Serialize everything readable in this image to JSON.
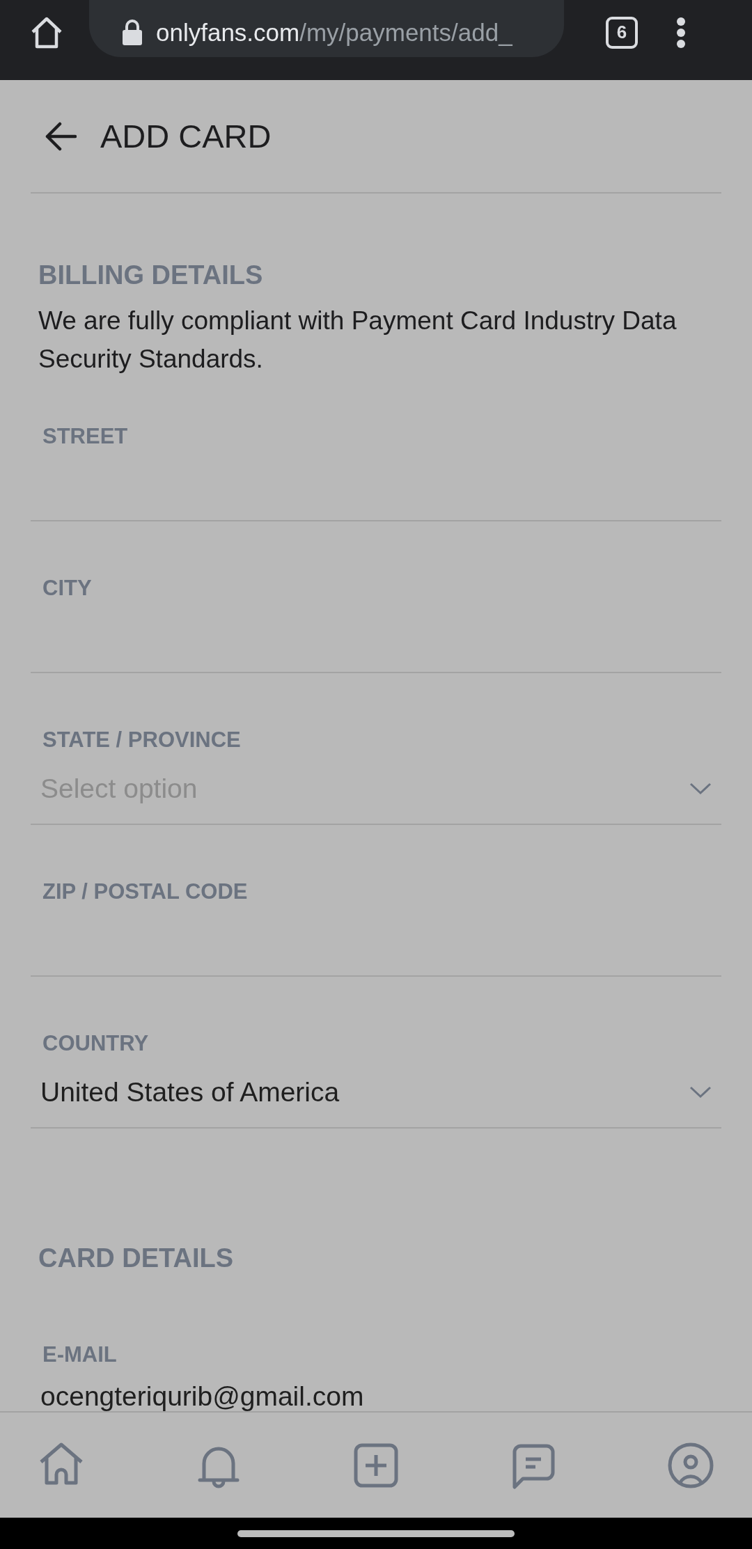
{
  "browser": {
    "url_host": "onlyfans.com",
    "url_path": "/my/payments/add_",
    "tab_count": "6"
  },
  "header": {
    "title": "ADD CARD"
  },
  "sections": [
    {
      "title": "BILLING DETAILS",
      "description": "We are fully compliant with Payment Card Industry Data Security Standards.",
      "fields": [
        {
          "kind": "text",
          "label": "STREET"
        },
        {
          "kind": "text",
          "label": "CITY"
        },
        {
          "kind": "select",
          "label": "STATE / PROVINCE",
          "placeholder": "Select option"
        },
        {
          "kind": "text",
          "label": "ZIP / POSTAL CODE"
        },
        {
          "kind": "select",
          "label": "COUNTRY",
          "value": "United States of America"
        }
      ]
    },
    {
      "title": "CARD DETAILS",
      "fields": [
        {
          "kind": "text",
          "label": "E-MAIL",
          "value": "ocengteriqurib@gmail.com"
        }
      ]
    }
  ],
  "bottom_nav": [
    {
      "kind": "home"
    },
    {
      "kind": "bell"
    },
    {
      "kind": "add"
    },
    {
      "kind": "chat"
    },
    {
      "kind": "profile"
    }
  ]
}
